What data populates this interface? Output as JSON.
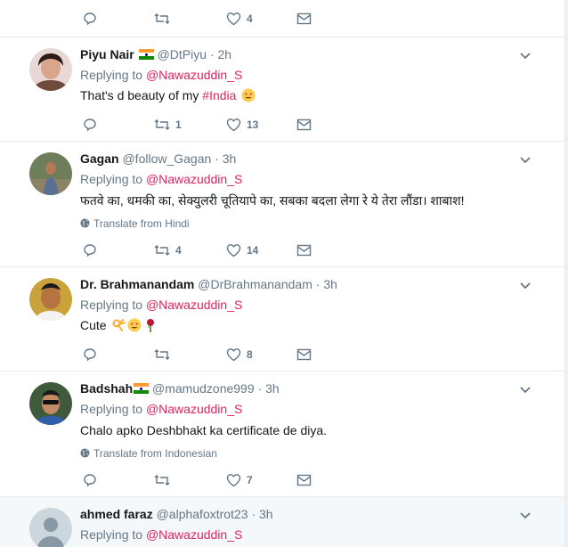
{
  "top_actions": {
    "like_count": "4"
  },
  "tweets": [
    {
      "name": "Piyu Nair",
      "handle": "@DtPiyu",
      "time": "· 2h",
      "reply_prefix": "Replying to",
      "reply_to": "@Nawazuddin_S",
      "text": "That's d beauty of my ",
      "hashtag": "#India",
      "reply_count": "",
      "retweet_count": "1",
      "like_count": "13"
    },
    {
      "name": "Gagan",
      "handle": "@follow_Gagan",
      "time": "· 3h",
      "reply_prefix": "Replying to",
      "reply_to": "@Nawazuddin_S",
      "text": "फतवे का, धमकी का, सेक्युलरी चूतियापे का, सबका बदला लेगा रे ये तेरा लौंडा। शाबाश!",
      "translate": "Translate from Hindi",
      "retweet_count": "4",
      "like_count": "14"
    },
    {
      "name": "Dr. Brahmanandam",
      "handle": "@DrBrahmanandam",
      "time": "· 3h",
      "reply_prefix": "Replying to",
      "reply_to": "@Nawazuddin_S",
      "text": "Cute",
      "retweet_count": "",
      "like_count": "8"
    },
    {
      "name": "Badshah",
      "handle": "@mamudzone999",
      "time": "· 3h",
      "reply_prefix": "Replying to",
      "reply_to": "@Nawazuddin_S",
      "text": "Chalo apko Deshbhakt ka certificate de diya.",
      "translate": "Translate from Indonesian",
      "retweet_count": "",
      "like_count": "7"
    },
    {
      "name": "ahmed faraz",
      "handle": "@alphafoxtrot23",
      "time": "· 3h",
      "reply_prefix": "Replying to",
      "reply_to": "@Nawazuddin_S"
    }
  ],
  "colors": {
    "mention": "#e0245e",
    "muted": "#657786",
    "text": "#14171a"
  }
}
